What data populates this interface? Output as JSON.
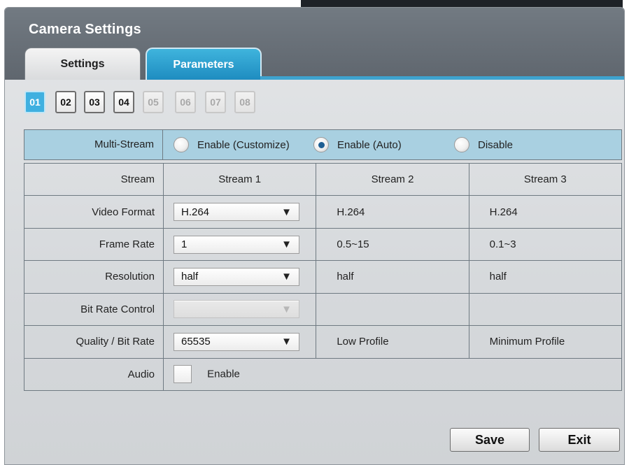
{
  "window": {
    "title": "Camera Settings"
  },
  "tabs": [
    {
      "label": "Settings",
      "active": false
    },
    {
      "label": "Parameters",
      "active": true
    }
  ],
  "channels": [
    {
      "label": "01",
      "state": "active"
    },
    {
      "label": "02",
      "state": "normal"
    },
    {
      "label": "03",
      "state": "normal"
    },
    {
      "label": "04",
      "state": "normal"
    },
    {
      "label": "05",
      "state": "disabled"
    },
    {
      "label": "06",
      "state": "disabled"
    },
    {
      "label": "07",
      "state": "disabled"
    },
    {
      "label": "08",
      "state": "disabled"
    }
  ],
  "multistream": {
    "label": "Multi-Stream",
    "options": [
      {
        "label": "Enable (Customize)",
        "checked": false
      },
      {
        "label": "Enable (Auto)",
        "checked": true
      },
      {
        "label": "Disable",
        "checked": false
      }
    ]
  },
  "table": {
    "header_label": "Stream",
    "columns": [
      "Stream 1",
      "Stream 2",
      "Stream 3"
    ],
    "rows": {
      "video_format": {
        "label": "Video Format",
        "s1": "H.264",
        "s2": "H.264",
        "s3": "H.264"
      },
      "frame_rate": {
        "label": "Frame Rate",
        "s1": "1",
        "s2": "0.5~15",
        "s3": "0.1~3"
      },
      "resolution": {
        "label": "Resolution",
        "s1": "half",
        "s2": "half",
        "s3": "half"
      },
      "bit_rate_control": {
        "label": "Bit Rate Control",
        "s1": "",
        "s2": "",
        "s3": ""
      },
      "quality": {
        "label": "Quality / Bit Rate",
        "s1": "65535",
        "s2": "Low Profile",
        "s3": "Minimum Profile"
      },
      "audio": {
        "label": "Audio",
        "checkbox_label": "Enable",
        "checked": false
      }
    }
  },
  "buttons": {
    "save": "Save",
    "exit": "Exit"
  },
  "colors": {
    "accent": "#3fb0e0",
    "multistream_bg": "#a9d0e1",
    "titlebar": "#6a7179"
  },
  "icons": {
    "dropdown": "▼"
  }
}
